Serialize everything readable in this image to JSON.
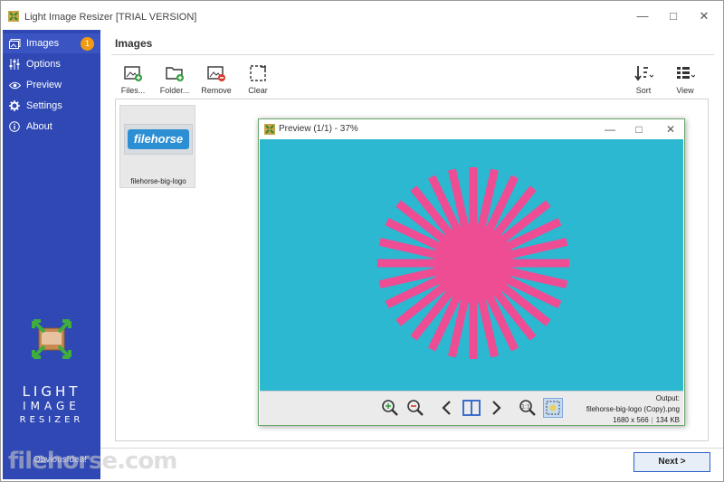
{
  "window": {
    "title": "Light Image Resizer  [TRIAL VERSION]"
  },
  "sidebar": {
    "items": [
      {
        "label": "Images",
        "icon": "images-icon",
        "badge": "1"
      },
      {
        "label": "Options",
        "icon": "sliders-icon"
      },
      {
        "label": "Preview",
        "icon": "eye-icon"
      },
      {
        "label": "Settings",
        "icon": "gear-icon"
      },
      {
        "label": "About",
        "icon": "info-icon"
      }
    ],
    "logo_lines": [
      "LIGHT",
      "IMAGE",
      "RESIZER"
    ],
    "brand": "ObviousIdea!"
  },
  "main": {
    "title": "Images",
    "toolbar": {
      "files": "Files...",
      "folder": "Folder...",
      "remove": "Remove",
      "clear": "Clear",
      "sort": "Sort",
      "view": "View"
    },
    "thumbnail": {
      "name": "filehorse-big-logo",
      "logo_text": "filehorse"
    }
  },
  "preview": {
    "title": "Preview (1/1) - 37%",
    "output_label": "Output:",
    "output_name": "filehorse-big-logo (Copy).png",
    "dimensions": "1680 x 566",
    "size": "134 KB"
  },
  "footer": {
    "next": "Next >",
    "watermark": "filehorse.com"
  },
  "colors": {
    "sidebar": "#2f48b4",
    "accent": "#f39a12",
    "canvas": "#2bb8d0",
    "burst": "#ee4d94"
  }
}
